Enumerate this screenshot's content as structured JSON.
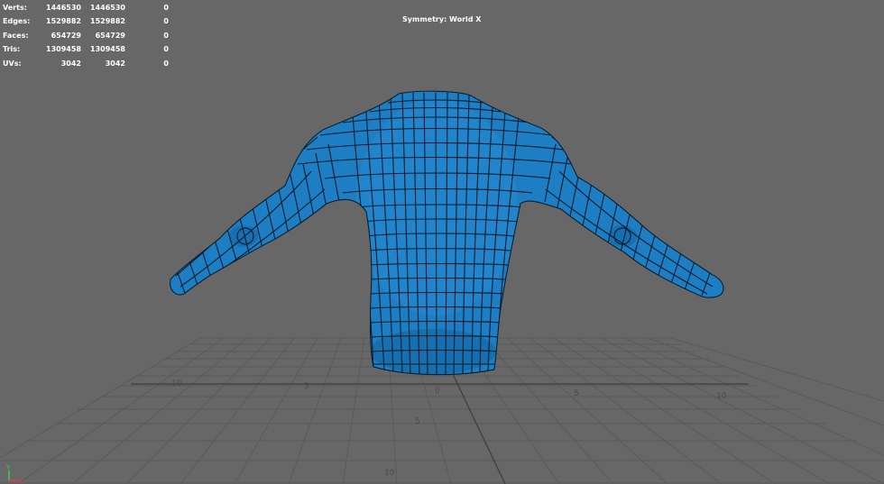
{
  "hud": {
    "rows": [
      {
        "label": "Verts:",
        "v1": "1446530",
        "v2": "1446530",
        "v3": "0"
      },
      {
        "label": "Edges:",
        "v1": "1529882",
        "v2": "1529882",
        "v3": "0"
      },
      {
        "label": "Faces:",
        "v1": "654729",
        "v2": "654729",
        "v3": "0"
      },
      {
        "label": "Tris:",
        "v1": "1309458",
        "v2": "1309458",
        "v3": "0"
      },
      {
        "label": "UVs:",
        "v1": "3042",
        "v2": "3042",
        "v3": "0"
      }
    ]
  },
  "symmetry": "Symmetry: World X",
  "grid_labels": {
    "left_10": "10",
    "left_5": "5",
    "center_0": "0",
    "right_5": "5",
    "right_10": "10",
    "near_5": "5",
    "near_10": "10"
  },
  "axis": {
    "y_label": "Y",
    "x_label": "X"
  },
  "colors": {
    "background": "#676767",
    "mesh": "#1d7ec4",
    "wire": "#0a1a28",
    "grid": "#5c5c5c"
  }
}
